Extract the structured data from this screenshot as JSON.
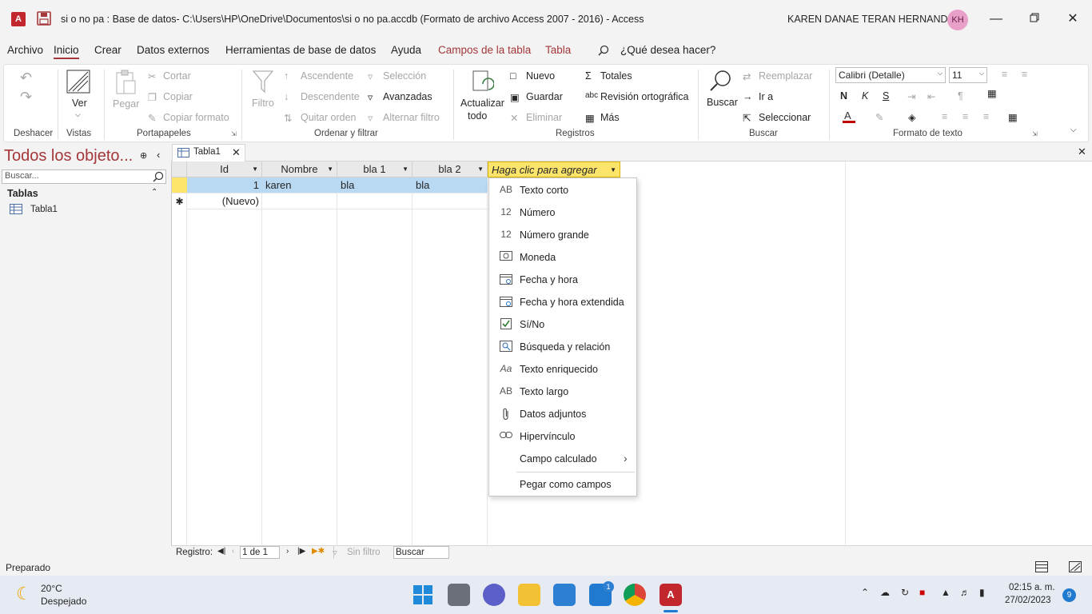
{
  "titlebar": {
    "app_icon": "A",
    "title": "si o no pa : Base de datos- C:\\Users\\HP\\OneDrive\\Documentos\\si o no pa.accdb (Formato de archivo Access 2007 - 2016)  -  Access",
    "user": "KAREN DANAE TERAN HERNANDEZ",
    "initials": "KH"
  },
  "menu_tabs": [
    {
      "label": "Archivo"
    },
    {
      "label": "Inicio"
    },
    {
      "label": "Crear"
    },
    {
      "label": "Datos externos"
    },
    {
      "label": "Herramientas de base de datos"
    },
    {
      "label": "Ayuda"
    },
    {
      "label": "Campos de la tabla"
    },
    {
      "label": "Tabla"
    },
    {
      "label": "¿Qué desea hacer?"
    }
  ],
  "ribbon": {
    "groups": [
      "Deshacer",
      "Vistas",
      "Portapapeles",
      "Ordenar y filtrar",
      "Registros",
      "Buscar",
      "Formato de texto"
    ],
    "ver": "Ver",
    "pegar": "Pegar",
    "cortar": "Cortar",
    "copiar": "Copiar",
    "copiar_formato": "Copiar formato",
    "filtro": "Filtro",
    "ascendente": "Ascendente",
    "descendente": "Descendente",
    "quitar_orden": "Quitar orden",
    "seleccion": "Selección",
    "avanzadas": "Avanzadas",
    "alternar_filtro": "Alternar filtro",
    "actualizar": "Actualizar",
    "todo": "todo",
    "nuevo": "Nuevo",
    "guardar": "Guardar",
    "eliminar": "Eliminar",
    "totales": "Totales",
    "revision": "Revisión ortográfica",
    "mas": "Más",
    "buscar": "Buscar",
    "reemplazar": "Reemplazar",
    "ir_a": "Ir a",
    "seleccionar": "Seleccionar",
    "font": "Calibri (Detalle)",
    "size": "11",
    "bold": "N",
    "italic": "K",
    "underline": "S"
  },
  "navpane": {
    "heading": "Todos los objeto...",
    "search_placeholder": "Buscar...",
    "section": "Tablas",
    "items": [
      "Tabla1"
    ]
  },
  "doc_tab": "Tabla1",
  "grid": {
    "headers": [
      "Id",
      "Nombre",
      "bla 1",
      "bla 2",
      "Haga clic para agregar"
    ],
    "rows": [
      {
        "id": "1",
        "nombre": "karen",
        "bla1": "bla",
        "bla2": "bla"
      }
    ],
    "new_row": "(Nuevo)"
  },
  "dropdown": [
    {
      "icon": "AB",
      "label": "Texto corto"
    },
    {
      "icon": "12",
      "label": "Número"
    },
    {
      "icon": "12",
      "label": "Número grande"
    },
    {
      "icon": "currency-icon",
      "label": "Moneda"
    },
    {
      "icon": "calendar-icon",
      "label": "Fecha y hora"
    },
    {
      "icon": "calendar-icon",
      "label": "Fecha y hora extendida"
    },
    {
      "icon": "checkbox-icon",
      "label": "Sí/No"
    },
    {
      "icon": "lookup-icon",
      "label": "Búsqueda y relación"
    },
    {
      "icon": "Aa",
      "label": "Texto enriquecido"
    },
    {
      "icon": "AB",
      "label": "Texto largo"
    },
    {
      "icon": "paperclip-icon",
      "label": "Datos adjuntos"
    },
    {
      "icon": "link-icon",
      "label": "Hipervínculo"
    },
    {
      "icon": "",
      "label": "Campo calculado"
    },
    {
      "icon": "",
      "label": "Pegar como campos"
    }
  ],
  "recnav": {
    "label": "Registro:",
    "position": "1 de 1",
    "filter": "Sin filtro",
    "search": "Buscar"
  },
  "status": "Preparado",
  "taskbar": {
    "temp": "20°C",
    "weather": "Despejado",
    "time": "02:15 a. m.",
    "date": "27/02/2023",
    "mail_badge": "1",
    "notif": "9"
  }
}
